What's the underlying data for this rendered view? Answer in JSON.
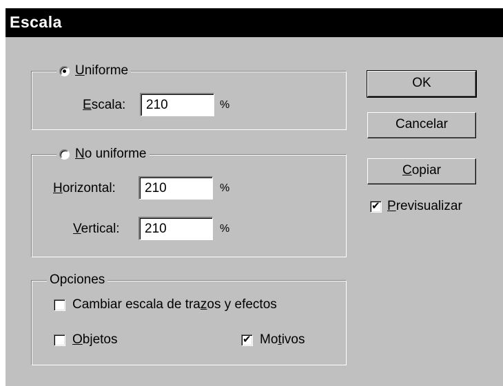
{
  "window": {
    "title": "Escala"
  },
  "uniform": {
    "legend_mnemonic": "U",
    "legend_rest": "niforme",
    "selected": true,
    "scale_label_mnemonic": "E",
    "scale_label_rest": "scala:",
    "scale_value": "210",
    "unit": "%"
  },
  "non_uniform": {
    "legend_mnemonic": "N",
    "legend_rest": "o uniforme",
    "selected": false,
    "horizontal_label_mnemonic": "H",
    "horizontal_label_rest": "orizontal:",
    "horizontal_value": "210",
    "horizontal_unit": "%",
    "vertical_label_mnemonic": "V",
    "vertical_label_rest": "ertical:",
    "vertical_value": "210",
    "vertical_unit": "%"
  },
  "options": {
    "legend": "Opciones",
    "scale_strokes_pre": "Cambiar escala de tra",
    "scale_strokes_mnemonic": "z",
    "scale_strokes_post": "os y efectos",
    "scale_strokes_checked": false,
    "objects_mnemonic": "O",
    "objects_rest": "bjetos",
    "objects_checked": false,
    "patterns_pre": "Mo",
    "patterns_mnemonic": "t",
    "patterns_post": "ivos",
    "patterns_checked": true
  },
  "buttons": {
    "ok": "OK",
    "cancel": "Cancelar",
    "copy_mnemonic": "C",
    "copy_rest": "opiar"
  },
  "preview": {
    "label_mnemonic": "P",
    "label_rest": "revisualizar",
    "checked": true
  }
}
